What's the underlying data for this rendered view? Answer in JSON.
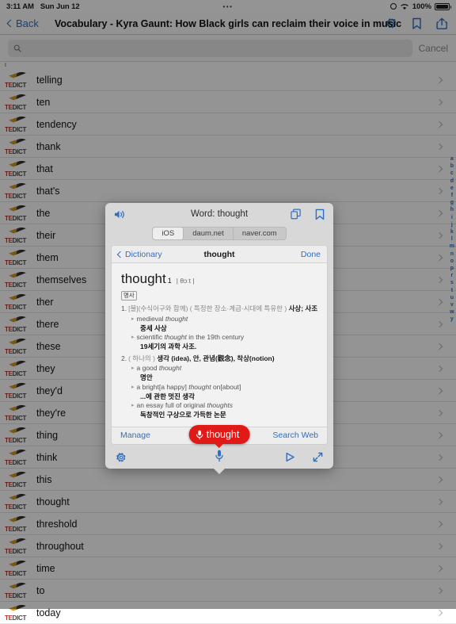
{
  "status_bar": {
    "time": "3:11 AM",
    "date": "Sun Jun 12",
    "dots": "•••",
    "battery_percent": "100%",
    "rotation_lock_icon": "rotation-lock-icon",
    "wifi_icon": "wifi-icon",
    "battery_icon": "battery-full-icon"
  },
  "nav_bar": {
    "back_label": "Back",
    "title": "Vocabulary - Kyra Gaunt: How Black girls can reclaim their voice in music",
    "icons": [
      "gear-icon",
      "bookmark-icon",
      "share-icon"
    ]
  },
  "search": {
    "placeholder": "",
    "value": "",
    "cancel_label": "Cancel",
    "icon": "search-icon"
  },
  "word_list": {
    "section_header": "t",
    "logo_text_primary": "TE",
    "logo_text_secondary": "DICT",
    "items": [
      {
        "word": "telling"
      },
      {
        "word": "ten"
      },
      {
        "word": "tendency"
      },
      {
        "word": "thank"
      },
      {
        "word": "that"
      },
      {
        "word": "that's"
      },
      {
        "word": "the"
      },
      {
        "word": "their"
      },
      {
        "word": "them"
      },
      {
        "word": "themselves"
      },
      {
        "word": "ther"
      },
      {
        "word": "there"
      },
      {
        "word": "these"
      },
      {
        "word": "they"
      },
      {
        "word": "they'd"
      },
      {
        "word": "they're"
      },
      {
        "word": "thing"
      },
      {
        "word": "think"
      },
      {
        "word": "this"
      },
      {
        "word": "thought"
      },
      {
        "word": "threshold"
      },
      {
        "word": "throughout"
      },
      {
        "word": "time"
      },
      {
        "word": "to"
      },
      {
        "word": "today"
      }
    ]
  },
  "alpha_index": {
    "letters": [
      "a",
      "b",
      "c",
      "d",
      "e",
      "f",
      "g",
      "h",
      "i",
      "j",
      "k",
      "l",
      "m",
      "n",
      "o",
      "p",
      "r",
      "s",
      "t",
      "u",
      "v",
      "w",
      "y"
    ]
  },
  "dialog": {
    "title": "Word: thought",
    "speaker_icon": "speaker-icon",
    "copy_icon": "copy-icon",
    "bookmark_icon": "bookmark-icon",
    "sources": [
      {
        "label": "iOS",
        "active": true
      },
      {
        "label": "daum.net",
        "active": false
      },
      {
        "label": "naver.com",
        "active": false
      }
    ],
    "dict_nav": {
      "back_label": "Dictionary",
      "title": "thought",
      "done_label": "Done"
    },
    "entry": {
      "headword": "thought",
      "superscript": "1",
      "ipa": "| θɔːt |",
      "pos_tag": "명사",
      "senses": [
        {
          "num": "1.",
          "gray_prefix": "[불](수식어구와 함께) ( 특정한 장소·계급·시대에 특유한 )",
          "definition": "사상; 사조",
          "examples": [
            {
              "en_pre": "medieval ",
              "en_it": "thought",
              "en_post": "",
              "ko": "중세 사상"
            },
            {
              "en_pre": "scientific ",
              "en_it": "thought",
              "en_post": " in the 19th century",
              "ko": "19세기의 과학 사조."
            }
          ]
        },
        {
          "num": "2.",
          "gray_prefix": "( 하나의 )",
          "definition": "생각 (idea), 안, 관념(觀念), 착상(notion)",
          "examples": [
            {
              "en_pre": "a good ",
              "en_it": "thought",
              "en_post": "",
              "ko": "명안"
            },
            {
              "en_pre": "a bright[a happy] ",
              "en_it": "thought",
              "en_post": " on[about]",
              "ko": "...에 관한 멋진 생각"
            },
            {
              "en_pre": "an essay full of original ",
              "en_it": "thoughts",
              "en_post": "",
              "ko": "독창적인 구상으로 가득한 논문"
            }
          ]
        }
      ]
    },
    "footer": {
      "manage_label": "Manage",
      "search_web_label": "Search Web"
    },
    "toolbar": {
      "gear_icon": "gear-icon",
      "mic_icon": "microphone-icon",
      "play_icon": "play-icon",
      "expand_icon": "expand-icon"
    },
    "mic_bubble": {
      "text": "thought",
      "icon": "microphone-icon",
      "color": "#e01b17"
    }
  }
}
